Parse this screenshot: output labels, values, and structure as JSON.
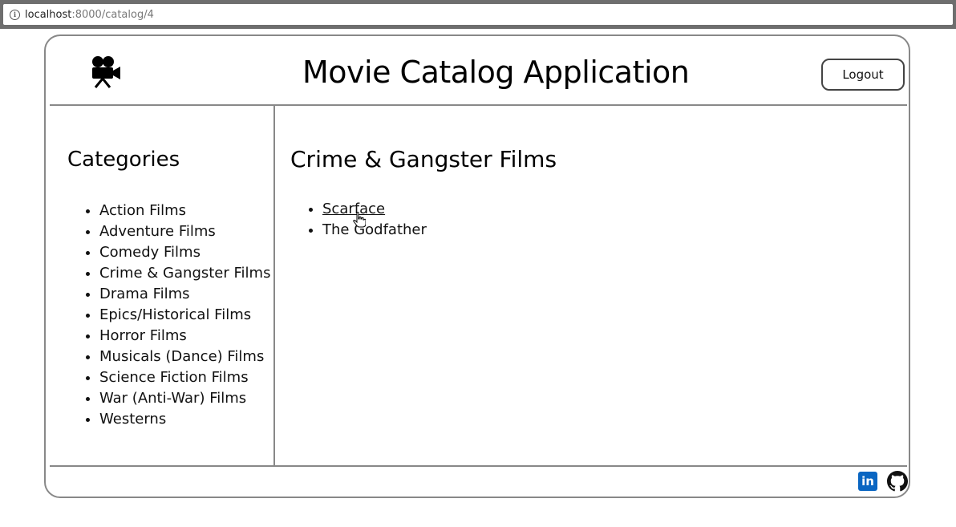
{
  "browser": {
    "url_host": "localhost",
    "url_path": ":8000/catalog/4"
  },
  "header": {
    "title": "Movie Catalog Application",
    "logout_label": "Logout",
    "logo_icon": "movie-camera-icon"
  },
  "sidebar": {
    "heading": "Categories",
    "items": [
      {
        "label": "Action Films"
      },
      {
        "label": "Adventure Films"
      },
      {
        "label": "Comedy Films"
      },
      {
        "label": "Crime & Gangster Films"
      },
      {
        "label": "Drama Films"
      },
      {
        "label": "Epics/Historical Films"
      },
      {
        "label": "Horror Films"
      },
      {
        "label": "Musicals (Dance) Films"
      },
      {
        "label": "Science Fiction Films"
      },
      {
        "label": "War (Anti-War) Films"
      },
      {
        "label": "Westerns"
      }
    ]
  },
  "main": {
    "category_title": "Crime & Gangster Films",
    "movies": [
      {
        "label": "Scarface",
        "hovered": true
      },
      {
        "label": "The Godfather",
        "hovered": false
      }
    ]
  },
  "footer": {
    "icons": [
      "linkedin-icon",
      "github-icon"
    ],
    "linkedin_text": "in"
  },
  "colors": {
    "border": "#888888",
    "linkedin_blue": "#0a66c2",
    "text": "#111111"
  }
}
